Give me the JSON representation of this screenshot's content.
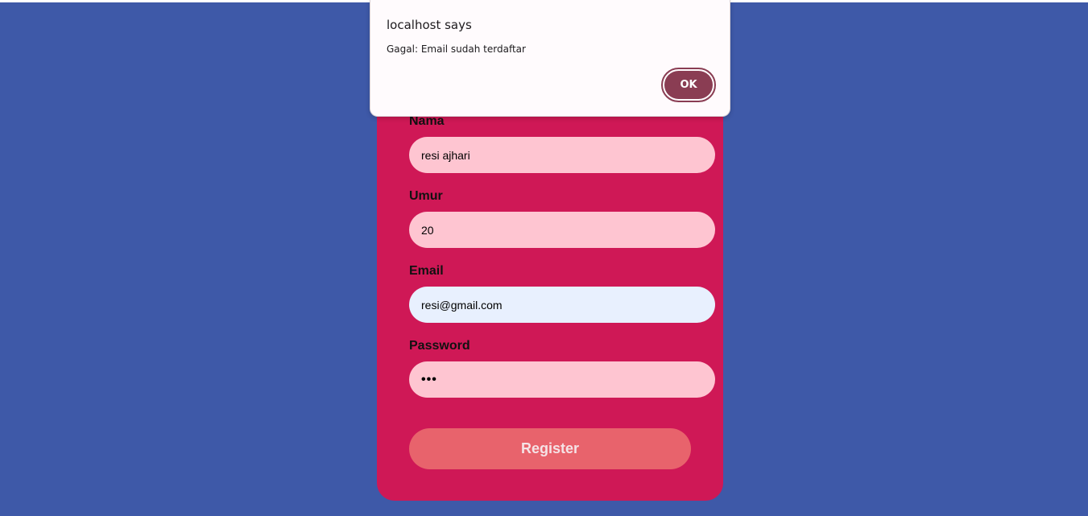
{
  "form": {
    "fields": [
      {
        "label": "Nama",
        "value": "resi ajhari"
      },
      {
        "label": "Umur",
        "value": "20"
      },
      {
        "label": "Email",
        "value": "resi@gmail.com"
      },
      {
        "label": "Password",
        "value": "•••"
      }
    ],
    "register_label": "Register"
  },
  "dialog": {
    "title": "localhost says",
    "message": "Gagal: Email sudah terdaftar",
    "ok_label": "OK"
  },
  "colors": {
    "background": "#3e59a8",
    "card": "#cf1856",
    "input": "#fec5d1",
    "input_autofill": "#e8f0fe",
    "button": "#e8636c",
    "dialog_button": "#8a3d53"
  }
}
